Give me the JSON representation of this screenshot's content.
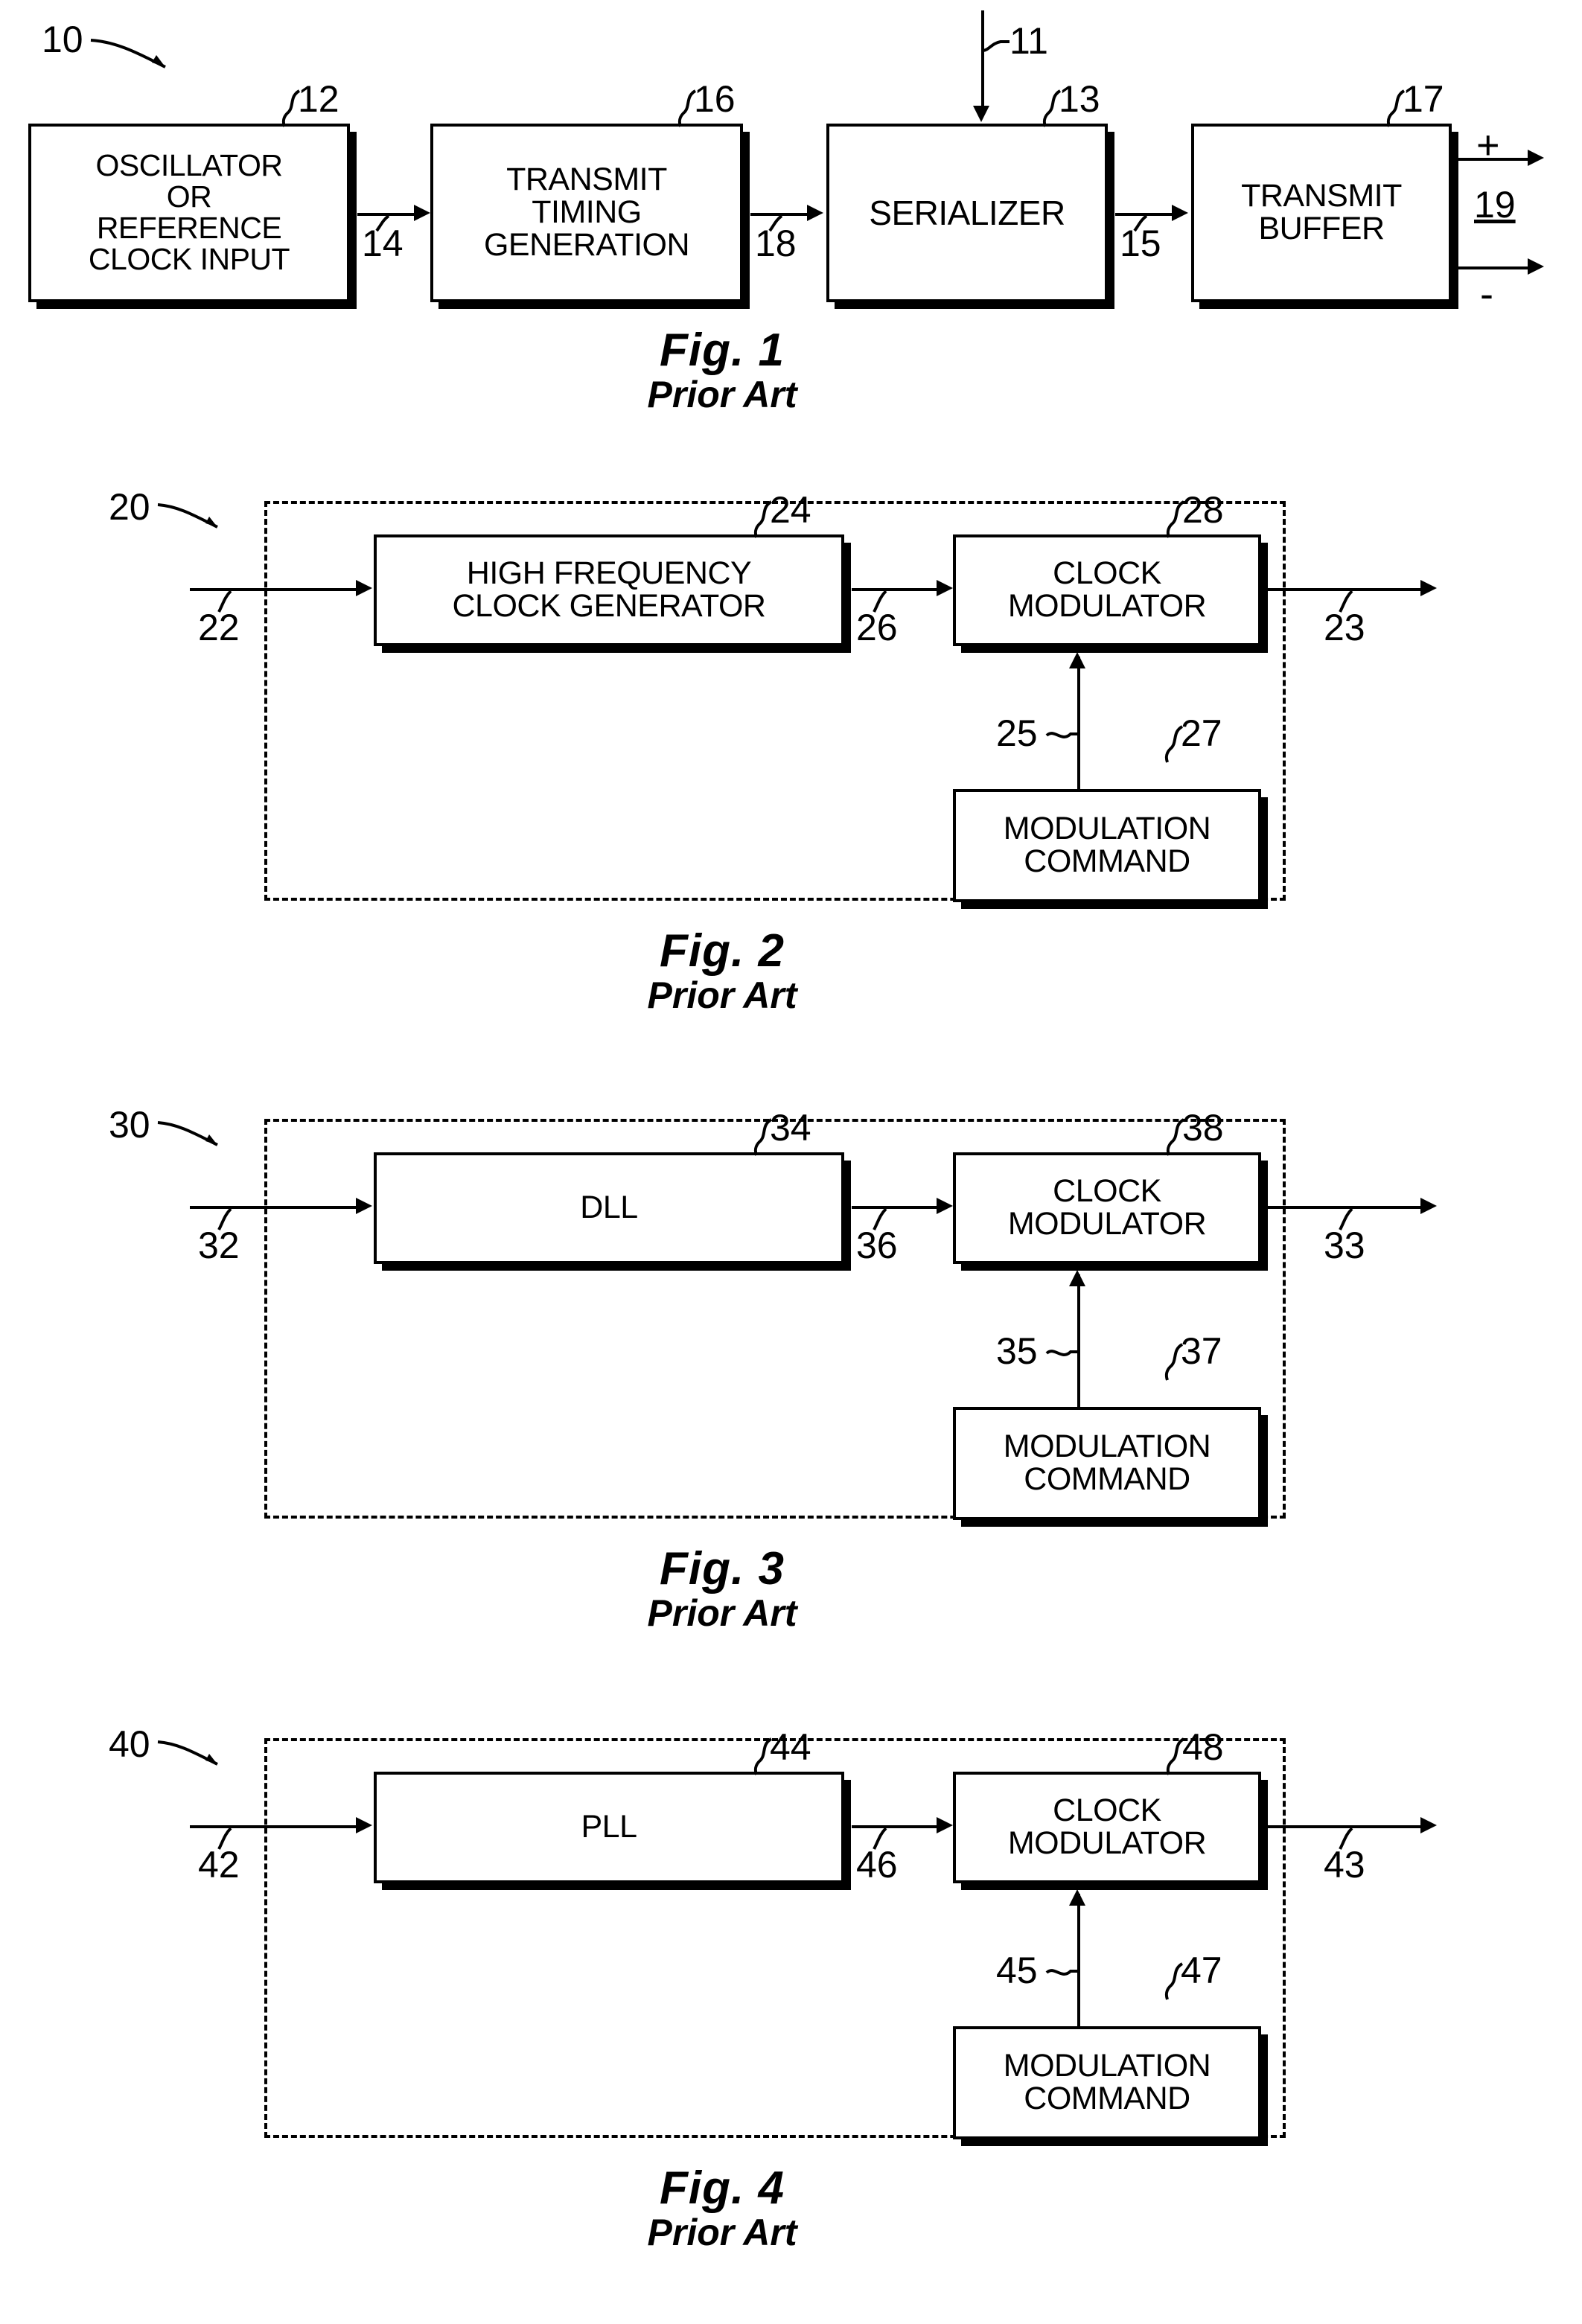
{
  "document": {
    "kind": "patent-drawing-sheet",
    "figure_count": 4
  },
  "figures": [
    {
      "id": "fig1",
      "caption_figure": "Fig. 1",
      "caption_note": "Prior Art",
      "system_ref": "10",
      "enclosure": false,
      "blocks": [
        {
          "id": "b12",
          "ref": "12",
          "label": "OSCILLATOR\nOR\nREFERENCE\nCLOCK INPUT"
        },
        {
          "id": "b16",
          "ref": "16",
          "label": "TRANSMIT\nTIMING\nGENERATION"
        },
        {
          "id": "b13",
          "ref": "13",
          "label": "SERIALIZER"
        },
        {
          "id": "b17",
          "ref": "17",
          "label": "TRANSMIT\nBUFFER"
        }
      ],
      "signal_refs": [
        "14",
        "18",
        "15",
        "11",
        "19"
      ],
      "output_marks": {
        "positive": "+",
        "negative": "-",
        "pair_ref": "19"
      }
    },
    {
      "id": "fig2",
      "caption_figure": "Fig. 2",
      "caption_note": "Prior Art",
      "system_ref": "20",
      "enclosure": true,
      "blocks": [
        {
          "id": "b24",
          "ref": "24",
          "label": "HIGH FREQUENCY\nCLOCK GENERATOR"
        },
        {
          "id": "b28",
          "ref": "28",
          "label": "CLOCK\nMODULATOR"
        },
        {
          "id": "b27",
          "ref": "27",
          "label": "MODULATION\nCOMMAND"
        }
      ],
      "signal_refs": {
        "input": "22",
        "interstage": "26",
        "output": "23",
        "command": "25"
      }
    },
    {
      "id": "fig3",
      "caption_figure": "Fig. 3",
      "caption_note": "Prior Art",
      "system_ref": "30",
      "enclosure": true,
      "blocks": [
        {
          "id": "b34",
          "ref": "34",
          "label": "DLL"
        },
        {
          "id": "b38",
          "ref": "38",
          "label": "CLOCK\nMODULATOR"
        },
        {
          "id": "b37",
          "ref": "37",
          "label": "MODULATION\nCOMMAND"
        }
      ],
      "signal_refs": {
        "input": "32",
        "interstage": "36",
        "output": "33",
        "command": "35"
      }
    },
    {
      "id": "fig4",
      "caption_figure": "Fig. 4",
      "caption_note": "Prior Art",
      "system_ref": "40",
      "enclosure": true,
      "blocks": [
        {
          "id": "b44",
          "ref": "44",
          "label": "PLL"
        },
        {
          "id": "b48",
          "ref": "48",
          "label": "CLOCK\nMODULATOR"
        },
        {
          "id": "b47",
          "ref": "47",
          "label": "MODULATION\nCOMMAND"
        }
      ],
      "signal_refs": {
        "input": "42",
        "interstage": "46",
        "output": "43",
        "command": "45"
      }
    }
  ],
  "colors": {
    "ink": "#000000",
    "paper": "#ffffff"
  }
}
